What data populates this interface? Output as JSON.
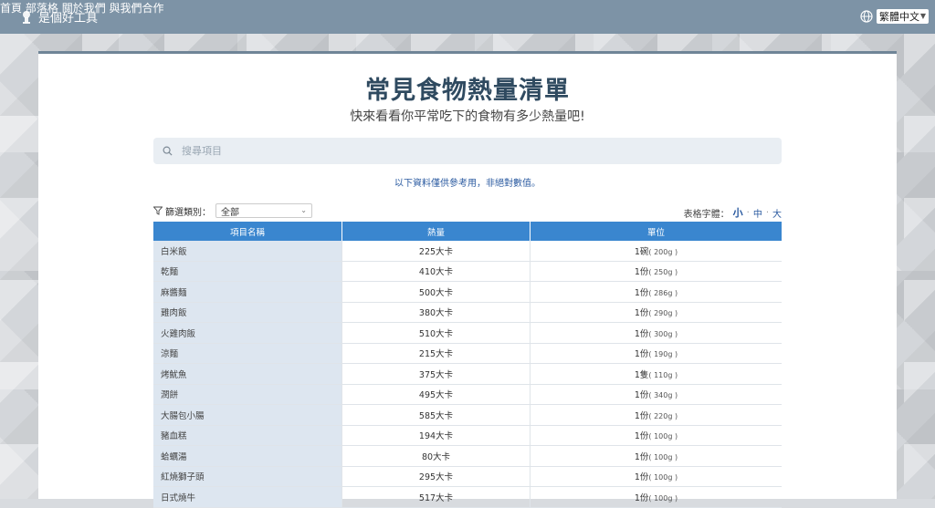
{
  "header": {
    "brand": "是個好工具",
    "nav": [
      "首頁",
      "部落格",
      "關於我們",
      "與我們合作"
    ],
    "language": "繁體中文"
  },
  "page": {
    "title": "常見食物熱量清單",
    "subtitle": "快來看看你平常吃下的食物有多少熱量吧!",
    "search_placeholder": "搜尋項目",
    "notice": "以下資料僅供參考用，非絕對數值。"
  },
  "filter": {
    "label": "篩選類別：",
    "selected": "全部"
  },
  "font_size": {
    "label": "表格字體：",
    "options": [
      "小",
      "中",
      "大"
    ]
  },
  "table": {
    "headers": [
      "項目名稱",
      "熱量",
      "單位"
    ],
    "rows": [
      {
        "name": "白米飯",
        "cal": "225大卡",
        "unit": "1碗",
        "weight": "( 200g )"
      },
      {
        "name": "乾麵",
        "cal": "410大卡",
        "unit": "1份",
        "weight": "( 250g )"
      },
      {
        "name": "麻醬麵",
        "cal": "500大卡",
        "unit": "1份",
        "weight": "( 286g )"
      },
      {
        "name": "雞肉飯",
        "cal": "380大卡",
        "unit": "1份",
        "weight": "( 290g )"
      },
      {
        "name": "火雞肉飯",
        "cal": "510大卡",
        "unit": "1份",
        "weight": "( 300g )"
      },
      {
        "name": "涼麵",
        "cal": "215大卡",
        "unit": "1份",
        "weight": "( 190g )"
      },
      {
        "name": "烤魷魚",
        "cal": "375大卡",
        "unit": "1隻",
        "weight": "( 110g )"
      },
      {
        "name": "潤餅",
        "cal": "495大卡",
        "unit": "1份",
        "weight": "( 340g )"
      },
      {
        "name": "大腸包小腸",
        "cal": "585大卡",
        "unit": "1份",
        "weight": "( 220g )"
      },
      {
        "name": "豬血糕",
        "cal": "194大卡",
        "unit": "1份",
        "weight": "( 100g )"
      },
      {
        "name": "蛤蠣湯",
        "cal": "80大卡",
        "unit": "1份",
        "weight": "( 100g )"
      },
      {
        "name": "紅燒獅子頭",
        "cal": "295大卡",
        "unit": "1份",
        "weight": "( 100g )"
      },
      {
        "name": "日式燒牛",
        "cal": "517大卡",
        "unit": "1份",
        "weight": "( 100g )"
      }
    ]
  }
}
